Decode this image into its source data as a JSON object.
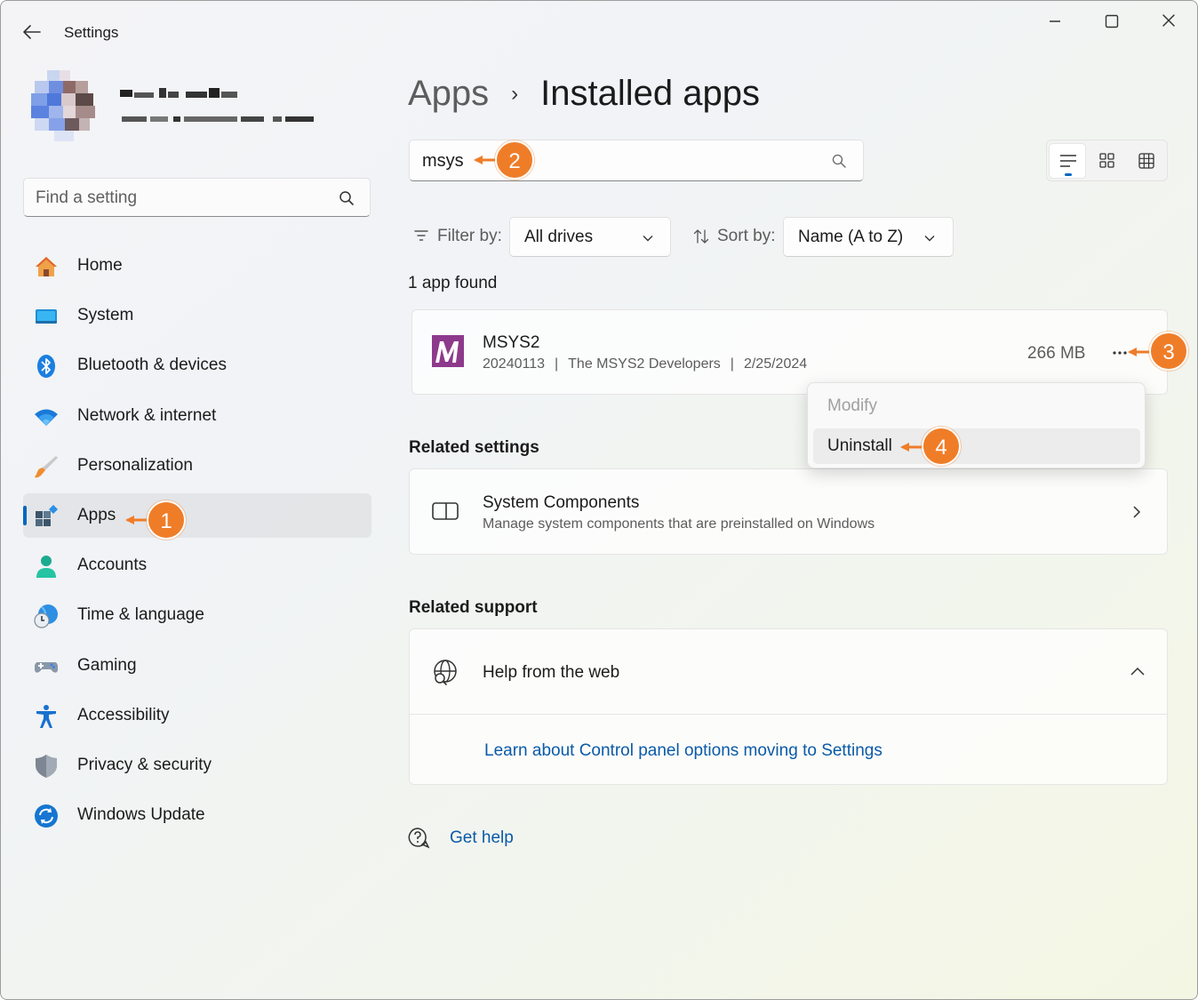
{
  "window": {
    "title": "Settings"
  },
  "sidebar": {
    "search_placeholder": "Find a setting",
    "items": [
      {
        "label": "Home",
        "icon": "home-icon"
      },
      {
        "label": "System",
        "icon": "system-icon"
      },
      {
        "label": "Bluetooth & devices",
        "icon": "bluetooth-icon"
      },
      {
        "label": "Network & internet",
        "icon": "wifi-icon"
      },
      {
        "label": "Personalization",
        "icon": "brush-icon"
      },
      {
        "label": "Apps",
        "icon": "apps-icon",
        "selected": true
      },
      {
        "label": "Accounts",
        "icon": "account-icon"
      },
      {
        "label": "Time & language",
        "icon": "clock-globe-icon"
      },
      {
        "label": "Gaming",
        "icon": "controller-icon"
      },
      {
        "label": "Accessibility",
        "icon": "accessibility-icon"
      },
      {
        "label": "Privacy & security",
        "icon": "shield-icon"
      },
      {
        "label": "Windows Update",
        "icon": "update-icon"
      }
    ]
  },
  "breadcrumb": {
    "parent": "Apps",
    "separator": "›",
    "current": "Installed apps"
  },
  "app_search": {
    "value": "msys"
  },
  "filters": {
    "filter_label": "Filter by:",
    "filter_value": "All drives",
    "sort_label": "Sort by:",
    "sort_value": "Name (A to Z)"
  },
  "results": {
    "count_text": "1 app found",
    "apps": [
      {
        "name": "MSYS2",
        "version": "20240113",
        "publisher": "The MSYS2 Developers",
        "date": "2/25/2024",
        "size": "266 MB"
      }
    ]
  },
  "context_menu": {
    "items": [
      "Modify",
      "Uninstall"
    ]
  },
  "related_settings": {
    "heading": "Related settings",
    "title": "System Components",
    "description": "Manage system components that are preinstalled on Windows"
  },
  "related_support": {
    "heading": "Related support",
    "title": "Help from the web",
    "link": "Learn about Control panel options moving to Settings"
  },
  "get_help": "Get help",
  "callouts": [
    "1",
    "2",
    "3",
    "4"
  ],
  "colors": {
    "accent": "#0067c0",
    "callout": "#ef7d28",
    "link": "#0a5aa8",
    "msys_logo": "#8e3a8c"
  }
}
